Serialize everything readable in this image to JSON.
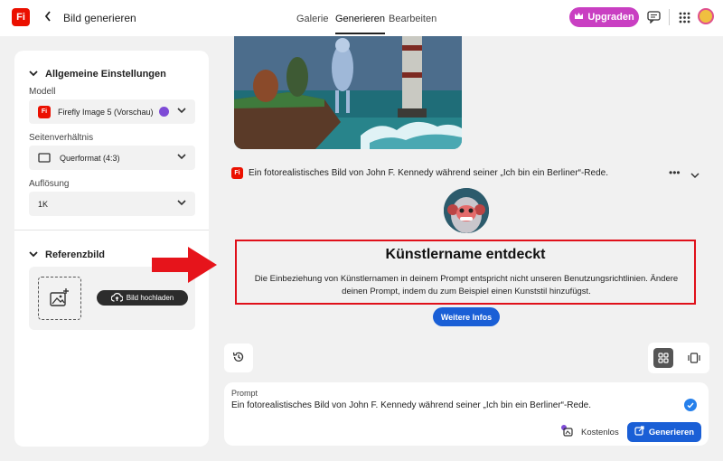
{
  "header": {
    "logo_text": "Fi",
    "back_label": "‹",
    "title": "Bild generieren",
    "tabs": [
      {
        "label": "Galerie"
      },
      {
        "label": "Generieren"
      },
      {
        "label": "Bearbeiten"
      }
    ],
    "upgrade_label": "Upgraden",
    "upgrade_color": "#c93fc2"
  },
  "sidebar": {
    "general_heading": "Allgemeine Einstellungen",
    "model_label": "Modell",
    "model_value": "Firefly Image 5 (Vorschau)",
    "aspect_label": "Seitenverhältnis",
    "aspect_value": "Querformat (4:3)",
    "resolution_label": "Auflösung",
    "resolution_value": "1K",
    "reference_heading": "Referenzbild",
    "upload_label": "Bild hochladen"
  },
  "main": {
    "prompt_display": "Ein fotorealistisches Bild von John F. Kennedy während seiner „Ich bin ein Berliner“-Rede.",
    "alert_title": "Künstlername entdeckt",
    "alert_body": "Die Einbeziehung von Künstlernamen in deinem Prompt entspricht nicht unseren Benutzungsrichtlinien. Ändere deinen Prompt, indem du zum Beispiel einen Kunststil hinzufügst.",
    "more_info_label": "Weitere Infos",
    "alert_border_color": "#e0101a",
    "accent_color": "#1a5fd6"
  },
  "prompt_panel": {
    "label": "Prompt",
    "text": "Ein fotorealistisches Bild von John F. Kennedy während seiner „Ich bin ein Berliner“-Rede.",
    "credits_label": "Kostenlos",
    "generate_label": "Generieren"
  }
}
